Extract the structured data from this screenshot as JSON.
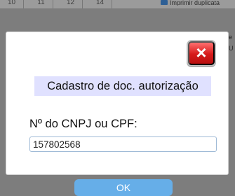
{
  "background": {
    "tabs": [
      "10",
      "11",
      "12",
      "14"
    ],
    "checkbox_label": "Imprimir duplicata",
    "right_text": [
      "e",
      "U"
    ]
  },
  "dialog": {
    "title": "Cadastro de doc. autorização",
    "label": "Nº do CNPJ ou CPF:",
    "input_value": "157802568",
    "ok_label": "OK",
    "close_icon": "close-icon"
  },
  "colors": {
    "overlay": "#7d7d7d",
    "dialog_bg": "#ffffff",
    "title_bg": "#e0e1ff",
    "input_border": "#9fbad6",
    "ok_button": "#66aee8",
    "close_button": "#d61a1a"
  }
}
